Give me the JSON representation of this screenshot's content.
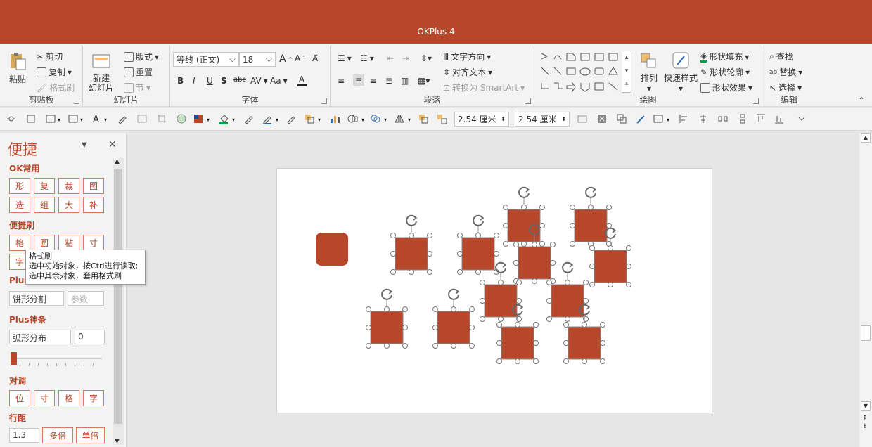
{
  "app": {
    "title": "OKPlus 4"
  },
  "colors": {
    "accent": "#b7472a",
    "shape_fill": "#b7472a"
  },
  "ribbon": {
    "clipboard": {
      "label": "剪贴板",
      "paste": "粘贴",
      "cut": "剪切",
      "copy": "复制",
      "format_painter": "格式刷"
    },
    "slides": {
      "label": "幻灯片",
      "new_slide": "新建",
      "new_slide2": "幻灯片",
      "layout": "版式",
      "reset": "重置",
      "section": "节"
    },
    "font": {
      "label": "字体",
      "name": "等线 (正文)",
      "size": "18",
      "bold": "B",
      "italic": "I",
      "underline": "U",
      "shadow": "S",
      "strike": "abc",
      "spacing": "AV",
      "case": "Aa",
      "color": "A"
    },
    "paragraph": {
      "label": "段落",
      "text_direction": "文字方向",
      "align_text": "对齐文本",
      "smartart": "转换为 SmartArt"
    },
    "drawing": {
      "label": "绘图",
      "arrange": "排列",
      "quick_styles": "快速样式",
      "fill": "形状填充",
      "outline": "形状轮廓",
      "effects": "形状效果"
    },
    "editing": {
      "label": "编辑",
      "find": "查找",
      "replace": "替换",
      "select": "选择"
    }
  },
  "toolbar2": {
    "width": "2.54 厘米",
    "height": "2.54 厘米"
  },
  "pane": {
    "title": "便捷",
    "ok_common": {
      "label": "OK常用",
      "buttons": [
        "形",
        "复",
        "裁",
        "图",
        "选",
        "组",
        "大",
        "补"
      ]
    },
    "brush": {
      "label": "便捷刷",
      "buttons": [
        "格",
        "圆",
        "粘",
        "寸",
        "字"
      ]
    },
    "plus_tools": {
      "label": "Plus",
      "input": "饼形分割",
      "param_placeholder": "参数"
    },
    "plus_line": {
      "label": "Plus神条",
      "input": "弧形分布",
      "value": "0"
    },
    "align": {
      "label": "对调",
      "buttons": [
        "位",
        "寸",
        "格",
        "字"
      ]
    },
    "line_spacing": {
      "label": "行距",
      "value": "1.3",
      "multi": "多倍",
      "single": "单倍"
    }
  },
  "tooltip": {
    "title": "格式刷",
    "line1": "选中初始对象，按Ctrl进行读取;",
    "line2": "选中其余对象，套用格式刷"
  }
}
